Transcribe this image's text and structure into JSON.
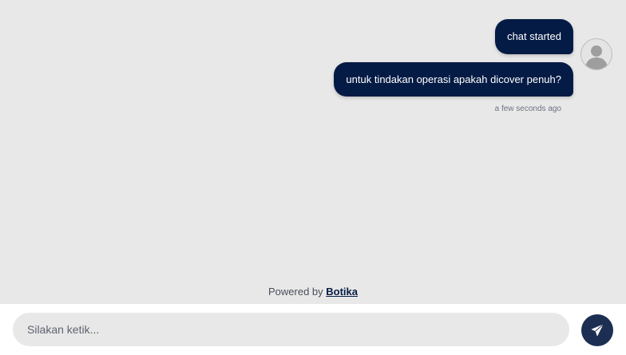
{
  "messages": [
    {
      "text": "chat started"
    },
    {
      "text": "untuk tindakan operasi apakah dicover penuh?"
    }
  ],
  "timestamp": "a few seconds ago",
  "footer": {
    "powered_prefix": "Powered by",
    "brand_link": "Botika"
  },
  "input": {
    "placeholder": "Silakan ketik..."
  },
  "icons": {
    "avatar": "user-avatar-icon",
    "send": "paper-plane-icon"
  },
  "colors": {
    "bubble": "#041b45",
    "send_button": "#1c2e52",
    "background": "#e8e8e8"
  }
}
